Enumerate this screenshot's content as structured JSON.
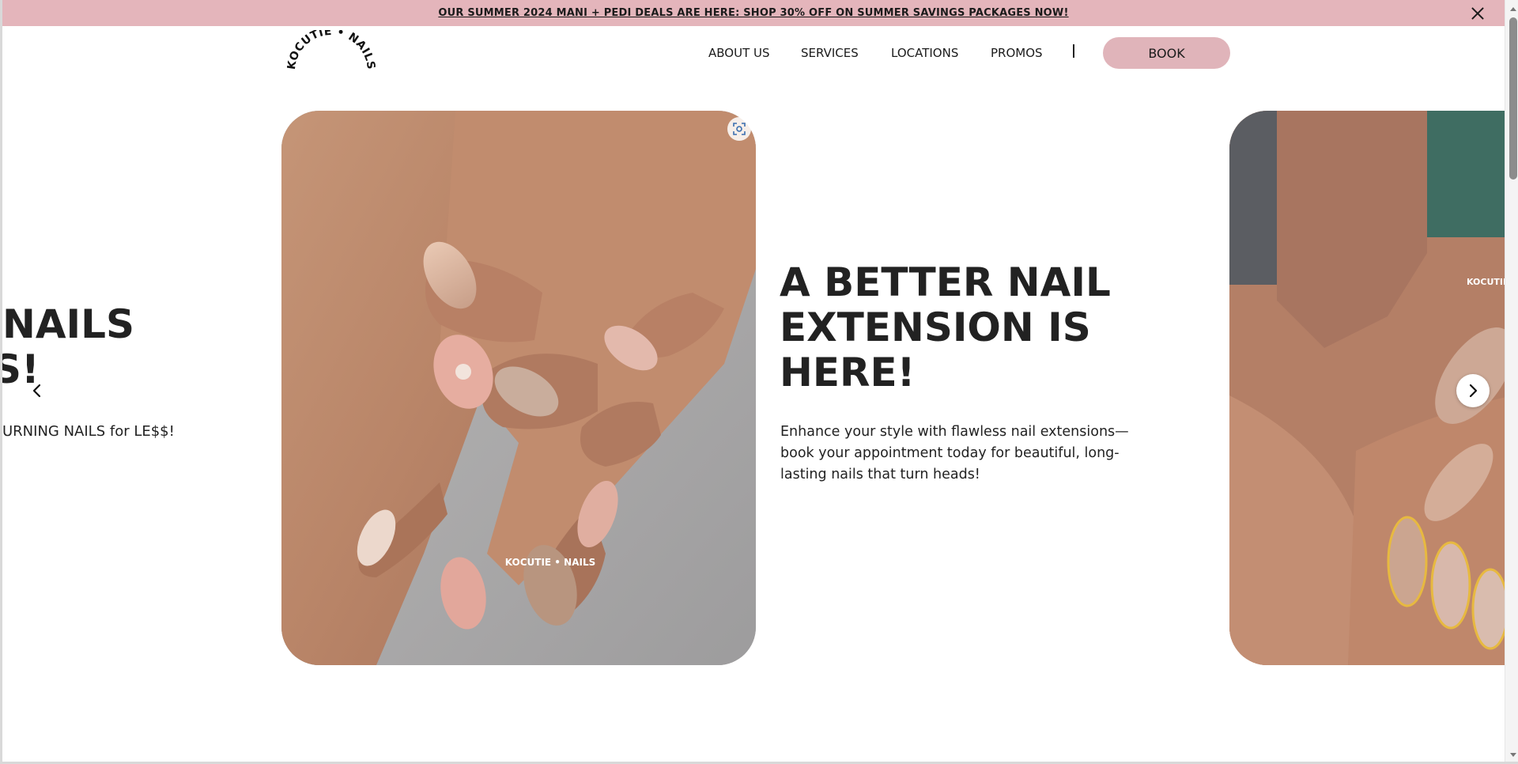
{
  "announcement": {
    "text": "OUR SUMMER 2024 MANI + PEDI DEALS ARE HERE: SHOP 30% OFF ON SUMMER SAVINGS PACKAGES NOW!",
    "close_icon": "close-icon"
  },
  "logo": {
    "text": "KOCUTIE • NAILS"
  },
  "nav": {
    "items": [
      {
        "label": "ABOUT US"
      },
      {
        "label": "SERVICES"
      },
      {
        "label": "LOCATIONS"
      },
      {
        "label": "PROMOS"
      }
    ],
    "book_label": "BOOK"
  },
  "carousel": {
    "prev_slide": {
      "heading_line1": "NAILS",
      "heading_line2": "S!",
      "subtext": "URNING NAILS for LE$$!"
    },
    "current_slide": {
      "heading": "A BETTER NAIL EXTENSION IS HERE!",
      "subtext": "Enhance your style with flawless nail extensions—book your appointment today for beautiful, long-lasting nails that turn heads!",
      "image_watermark": "KOCUTIE • NAILS"
    },
    "next_slide": {
      "image_watermark": "KOCUTIE • NAILS"
    },
    "prev_icon": "chevron-left-icon",
    "next_icon": "chevron-right-icon",
    "zoom_icon": "zoom-icon"
  },
  "colors": {
    "accent_pink": "#e4b5bb",
    "book_button": "#e0b4ba",
    "text": "#1f1f1f"
  }
}
